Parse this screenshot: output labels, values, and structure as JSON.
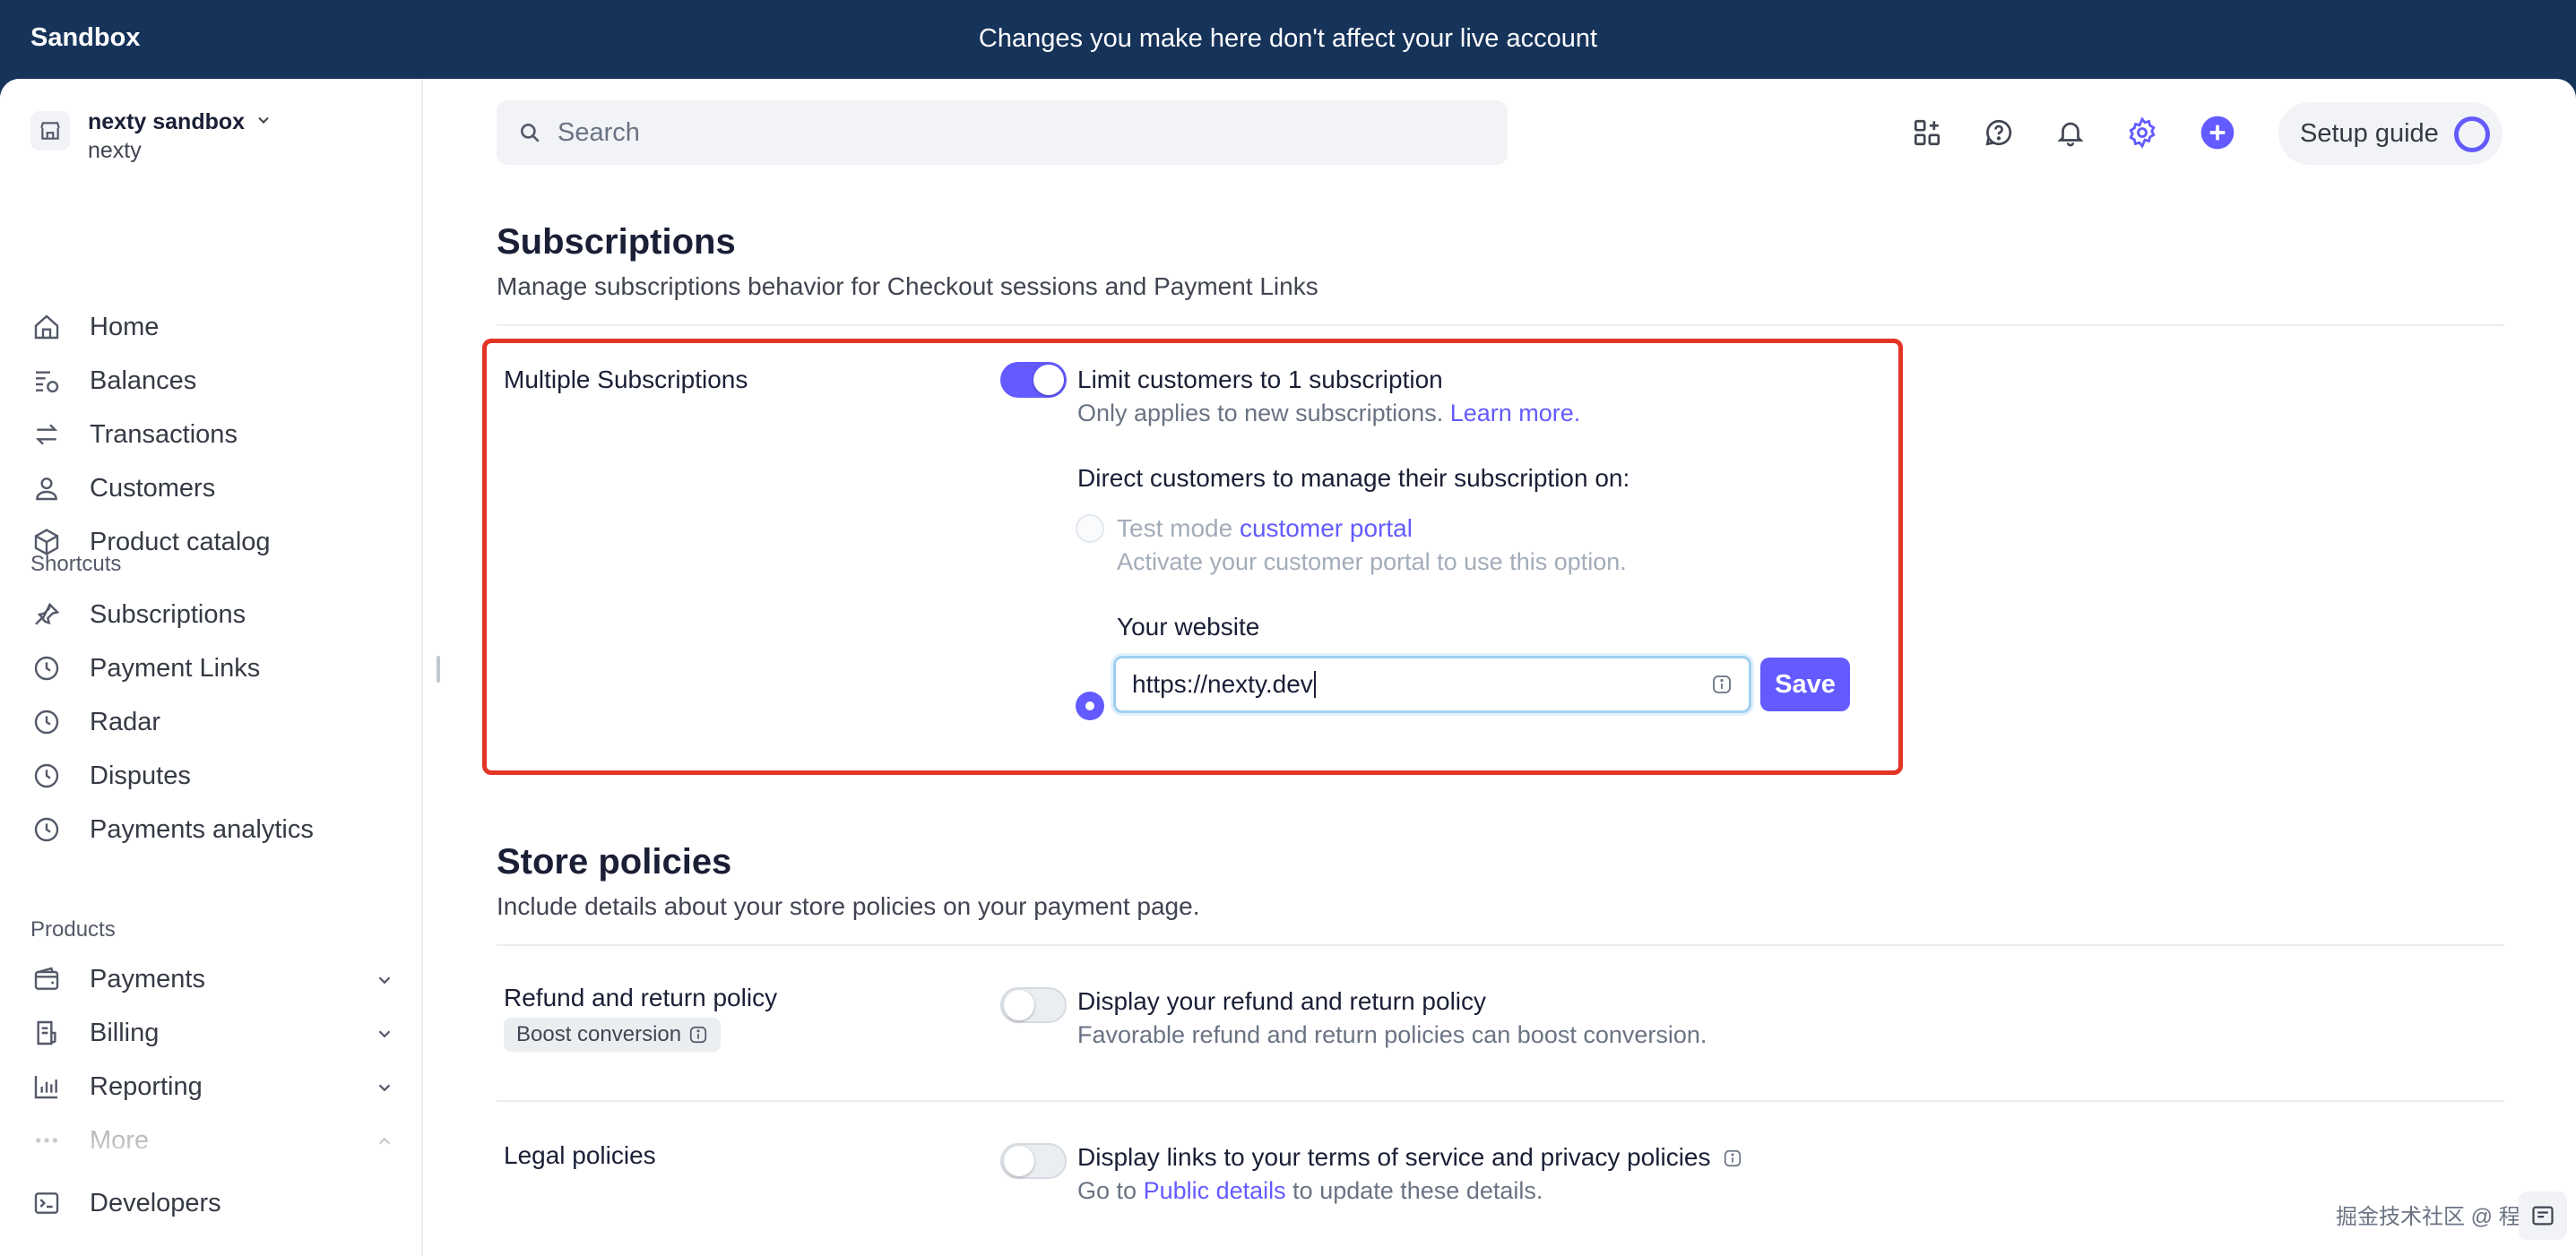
{
  "banner": {
    "env_label": "Sandbox",
    "message": "Changes you make here don't affect your live account"
  },
  "account": {
    "name": "nexty sandbox",
    "sub": "nexty"
  },
  "nav": {
    "main": [
      {
        "label": "Home",
        "icon": "home-icon"
      },
      {
        "label": "Balances",
        "icon": "balances-icon"
      },
      {
        "label": "Transactions",
        "icon": "transactions-icon"
      },
      {
        "label": "Customers",
        "icon": "customers-icon"
      },
      {
        "label": "Product catalog",
        "icon": "product-catalog-icon"
      }
    ],
    "shortcuts_label": "Shortcuts",
    "shortcuts": [
      {
        "label": "Subscriptions",
        "icon": "pin-icon"
      },
      {
        "label": "Payment Links",
        "icon": "clock-icon"
      },
      {
        "label": "Radar",
        "icon": "clock-icon"
      },
      {
        "label": "Disputes",
        "icon": "clock-icon"
      },
      {
        "label": "Payments analytics",
        "icon": "clock-icon"
      }
    ],
    "products_label": "Products",
    "products": [
      {
        "label": "Payments",
        "icon": "wallet-icon"
      },
      {
        "label": "Billing",
        "icon": "billing-icon"
      },
      {
        "label": "Reporting",
        "icon": "reporting-icon"
      },
      {
        "label": "More",
        "icon": "more-icon"
      }
    ],
    "developers": {
      "label": "Developers",
      "icon": "terminal-icon"
    }
  },
  "search": {
    "placeholder": "Search"
  },
  "setup_guide": {
    "label": "Setup guide"
  },
  "subscriptions": {
    "title": "Subscriptions",
    "description": "Manage subscriptions behavior for Checkout sessions and Payment Links",
    "multiple": {
      "label": "Multiple Subscriptions",
      "toggle_on": true,
      "toggle_title": "Limit customers to 1 subscription",
      "toggle_sub": "Only applies to new subscriptions.",
      "learn_more": "Learn more.",
      "direct_label": "Direct customers to manage their subscription on:",
      "portal_prefix": "Test mode",
      "portal_link": "customer portal",
      "portal_sub": "Activate your customer portal to use this option.",
      "website_label": "Your website",
      "website_value": "https://nexty.dev",
      "save_label": "Save"
    }
  },
  "store_policies": {
    "title": "Store policies",
    "description": "Include details about your store policies on your payment page.",
    "refund": {
      "label": "Refund and return policy",
      "badge": "Boost conversion",
      "toggle_on": false,
      "title": "Display your refund and return policy",
      "sub": "Favorable refund and return policies can boost conversion."
    },
    "legal": {
      "label": "Legal policies",
      "toggle_on": false,
      "title": "Display links to your terms of service and privacy policies",
      "sub_prefix": "Go to",
      "sub_link": "Public details",
      "sub_suffix": "to update these details."
    }
  },
  "watermark": "掘金技术社区 @ 程序"
}
